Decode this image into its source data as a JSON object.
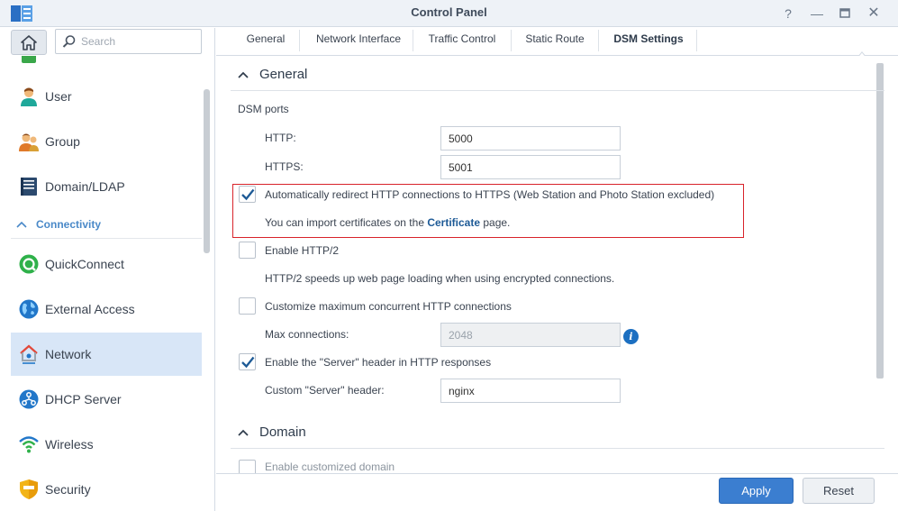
{
  "window": {
    "title": "Control Panel"
  },
  "search": {
    "placeholder": "Search"
  },
  "sidebar": {
    "section_connectivity": "Connectivity",
    "items": [
      {
        "label": "User",
        "icon": "user-icon"
      },
      {
        "label": "Group",
        "icon": "group-icon"
      },
      {
        "label": "Domain/LDAP",
        "icon": "domain-ldap-icon"
      },
      {
        "label": "QuickConnect",
        "icon": "quickconnect-icon"
      },
      {
        "label": "External Access",
        "icon": "globe-icon"
      },
      {
        "label": "Network",
        "icon": "network-house-icon",
        "active": true
      },
      {
        "label": "DHCP Server",
        "icon": "dhcp-icon"
      },
      {
        "label": "Wireless",
        "icon": "wifi-icon"
      },
      {
        "label": "Security",
        "icon": "shield-icon"
      }
    ]
  },
  "tabs": [
    "General",
    "Network Interface",
    "Traffic Control",
    "Static Route",
    "DSM Settings"
  ],
  "active_tab": "DSM Settings",
  "general": {
    "heading": "General",
    "dsm_ports_label": "DSM ports",
    "http_label": "HTTP:",
    "http_value": "5000",
    "https_label": "HTTPS:",
    "https_value": "5001",
    "redirect_label": "Automatically redirect HTTP connections to HTTPS (Web Station and Photo Station excluded)",
    "redirect_checked": true,
    "cert_note_prefix": "You can import certificates on the ",
    "cert_link": "Certificate",
    "cert_note_suffix": " page.",
    "http2_label": "Enable HTTP/2",
    "http2_checked": false,
    "http2_desc": "HTTP/2 speeds up web page loading when using encrypted connections.",
    "max_conn_label": "Customize maximum concurrent HTTP connections",
    "max_conn_checked": false,
    "max_connections_label": "Max connections:",
    "max_connections_value": "2048",
    "server_header_label": "Enable the \"Server\" header in HTTP responses",
    "server_header_checked": true,
    "custom_server_label": "Custom \"Server\" header:",
    "custom_server_value": "nginx"
  },
  "domain": {
    "heading": "Domain",
    "customized_label": "Enable customized domain"
  },
  "footer": {
    "apply": "Apply",
    "reset": "Reset"
  },
  "colors": {
    "accent": "#3b7ed0",
    "active_nav": "#d8e6f7",
    "highlight": "#d8232a",
    "section_title": "#4a89c8"
  }
}
